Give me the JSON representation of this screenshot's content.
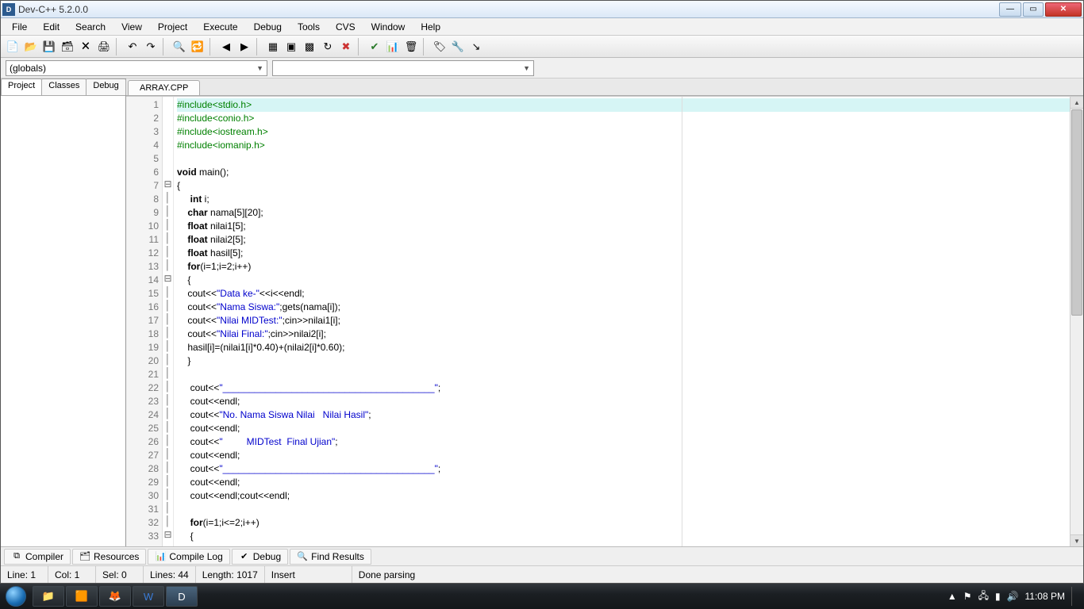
{
  "window": {
    "title": "Dev-C++ 5.2.0.0"
  },
  "menu": [
    "File",
    "Edit",
    "Search",
    "View",
    "Project",
    "Execute",
    "Debug",
    "Tools",
    "CVS",
    "Window",
    "Help"
  ],
  "combo1": "(globals)",
  "sidetabs": [
    "Project",
    "Classes",
    "Debug"
  ],
  "filetab": "ARRAY.CPP",
  "code": {
    "lines": [
      {
        "n": 1,
        "fold": "",
        "cls": "hl",
        "seg": [
          {
            "c": "pp",
            "t": "#include<stdio.h>"
          }
        ]
      },
      {
        "n": 2,
        "fold": "",
        "seg": [
          {
            "c": "pp",
            "t": "#include<conio.h>"
          }
        ]
      },
      {
        "n": 3,
        "fold": "",
        "seg": [
          {
            "c": "pp",
            "t": "#include<iostream.h>"
          }
        ]
      },
      {
        "n": 4,
        "fold": "",
        "seg": [
          {
            "c": "pp",
            "t": "#include<iomanip.h>"
          }
        ]
      },
      {
        "n": 5,
        "fold": "",
        "seg": [
          {
            "c": "",
            "t": ""
          }
        ]
      },
      {
        "n": 6,
        "fold": "",
        "seg": [
          {
            "c": "kw",
            "t": "void"
          },
          {
            "c": "",
            "t": " main();"
          }
        ]
      },
      {
        "n": 7,
        "fold": "⊟",
        "seg": [
          {
            "c": "",
            "t": "{"
          }
        ]
      },
      {
        "n": 8,
        "fold": "│",
        "seg": [
          {
            "c": "",
            "t": "     "
          },
          {
            "c": "kw",
            "t": "int"
          },
          {
            "c": "",
            "t": " i;"
          }
        ]
      },
      {
        "n": 9,
        "fold": "│",
        "seg": [
          {
            "c": "",
            "t": "    "
          },
          {
            "c": "kw",
            "t": "char"
          },
          {
            "c": "",
            "t": " nama[5][20];"
          }
        ]
      },
      {
        "n": 10,
        "fold": "│",
        "seg": [
          {
            "c": "",
            "t": "    "
          },
          {
            "c": "kw",
            "t": "float"
          },
          {
            "c": "",
            "t": " nilai1[5];"
          }
        ]
      },
      {
        "n": 11,
        "fold": "│",
        "seg": [
          {
            "c": "",
            "t": "    "
          },
          {
            "c": "kw",
            "t": "float"
          },
          {
            "c": "",
            "t": " nilai2[5];"
          }
        ]
      },
      {
        "n": 12,
        "fold": "│",
        "seg": [
          {
            "c": "",
            "t": "    "
          },
          {
            "c": "kw",
            "t": "float"
          },
          {
            "c": "",
            "t": " hasil[5];"
          }
        ]
      },
      {
        "n": 13,
        "fold": "│",
        "seg": [
          {
            "c": "",
            "t": "    "
          },
          {
            "c": "kw",
            "t": "for"
          },
          {
            "c": "",
            "t": "(i=1;i=2;i++)"
          }
        ]
      },
      {
        "n": 14,
        "fold": "⊟",
        "seg": [
          {
            "c": "",
            "t": "    {"
          }
        ]
      },
      {
        "n": 15,
        "fold": "│",
        "seg": [
          {
            "c": "",
            "t": "    cout<<"
          },
          {
            "c": "str",
            "t": "\"Data ke-\""
          },
          {
            "c": "",
            "t": "<<i<<endl;"
          }
        ]
      },
      {
        "n": 16,
        "fold": "│",
        "seg": [
          {
            "c": "",
            "t": "    cout<<"
          },
          {
            "c": "str",
            "t": "\"Nama Siswa:\""
          },
          {
            "c": "",
            "t": ";gets(nama[i]);"
          }
        ]
      },
      {
        "n": 17,
        "fold": "│",
        "seg": [
          {
            "c": "",
            "t": "    cout<<"
          },
          {
            "c": "str",
            "t": "\"Nilai MIDTest:\""
          },
          {
            "c": "",
            "t": ";cin>>nilai1[i];"
          }
        ]
      },
      {
        "n": 18,
        "fold": "│",
        "seg": [
          {
            "c": "",
            "t": "    cout<<"
          },
          {
            "c": "str",
            "t": "\"Nilai Final:\""
          },
          {
            "c": "",
            "t": ";cin>>nilai2[i];"
          }
        ]
      },
      {
        "n": 19,
        "fold": "│",
        "seg": [
          {
            "c": "",
            "t": "    hasil[i]=(nilai1[i]*0.40)+(nilai2[i]*0.60);"
          }
        ]
      },
      {
        "n": 20,
        "fold": "│",
        "seg": [
          {
            "c": "",
            "t": "    }"
          }
        ]
      },
      {
        "n": 21,
        "fold": "│",
        "seg": [
          {
            "c": "",
            "t": ""
          }
        ]
      },
      {
        "n": 22,
        "fold": "│",
        "seg": [
          {
            "c": "",
            "t": "     cout<<"
          },
          {
            "c": "str",
            "t": "\"________________________________________\""
          },
          {
            "c": "",
            "t": ";"
          }
        ]
      },
      {
        "n": 23,
        "fold": "│",
        "seg": [
          {
            "c": "",
            "t": "     cout<<endl;"
          }
        ]
      },
      {
        "n": 24,
        "fold": "│",
        "seg": [
          {
            "c": "",
            "t": "     cout<<"
          },
          {
            "c": "str",
            "t": "\"No. Nama Siswa Nilai   Nilai Hasil\""
          },
          {
            "c": "",
            "t": ";"
          }
        ]
      },
      {
        "n": 25,
        "fold": "│",
        "seg": [
          {
            "c": "",
            "t": "     cout<<endl;"
          }
        ]
      },
      {
        "n": 26,
        "fold": "│",
        "seg": [
          {
            "c": "",
            "t": "     cout<<"
          },
          {
            "c": "str",
            "t": "\"         MIDTest  Final Ujian\""
          },
          {
            "c": "",
            "t": ";"
          }
        ]
      },
      {
        "n": 27,
        "fold": "│",
        "seg": [
          {
            "c": "",
            "t": "     cout<<endl;"
          }
        ]
      },
      {
        "n": 28,
        "fold": "│",
        "seg": [
          {
            "c": "",
            "t": "     cout<<"
          },
          {
            "c": "str",
            "t": "\"________________________________________\""
          },
          {
            "c": "",
            "t": ";"
          }
        ]
      },
      {
        "n": 29,
        "fold": "│",
        "seg": [
          {
            "c": "",
            "t": "     cout<<endl;"
          }
        ]
      },
      {
        "n": 30,
        "fold": "│",
        "seg": [
          {
            "c": "",
            "t": "     cout<<endl;cout<<endl;"
          }
        ]
      },
      {
        "n": 31,
        "fold": "│",
        "seg": [
          {
            "c": "",
            "t": ""
          }
        ]
      },
      {
        "n": 32,
        "fold": "│",
        "seg": [
          {
            "c": "",
            "t": "     "
          },
          {
            "c": "kw",
            "t": "for"
          },
          {
            "c": "",
            "t": "(i=1;i<=2;i++)"
          }
        ]
      },
      {
        "n": 33,
        "fold": "⊟",
        "seg": [
          {
            "c": "",
            "t": "     {"
          }
        ]
      }
    ]
  },
  "bottomtabs": [
    {
      "icon": "⧉",
      "label": "Compiler"
    },
    {
      "icon": "🗂",
      "label": "Resources"
    },
    {
      "icon": "📊",
      "label": "Compile Log"
    },
    {
      "icon": "✔",
      "label": "Debug"
    },
    {
      "icon": "🔍",
      "label": "Find Results"
    }
  ],
  "status": {
    "line": "Line:   1",
    "col": "Col:   1",
    "sel": "Sel:   0",
    "lines": "Lines:   44",
    "length": "Length:  1017",
    "mode": "Insert",
    "msg": "Done parsing"
  },
  "taskbar": {
    "time": "11:08 PM"
  }
}
